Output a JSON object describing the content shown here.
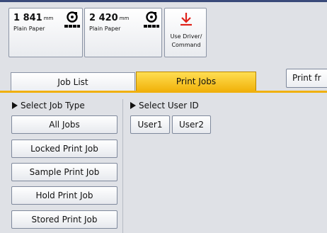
{
  "trays": [
    {
      "size_value": "1 841",
      "size_unit": "mm",
      "paper_type": "Plain Paper",
      "icon": "paper-roll-icon"
    },
    {
      "size_value": "2 420",
      "size_unit": "mm",
      "paper_type": "Plain Paper",
      "icon": "paper-roll-icon"
    }
  ],
  "driver_setting": {
    "icon": "download-arrow-icon",
    "label": "Use Driver/ Command",
    "line1": "Use Driver/",
    "line2": "Command",
    "icon_color": "#e0221a"
  },
  "tabs": [
    {
      "label": "Job List",
      "active": false
    },
    {
      "label": "Print Jobs",
      "active": true
    }
  ],
  "print_from_button": {
    "label": "Print fr"
  },
  "job_type_section": {
    "heading": "Select Job Type",
    "buttons": [
      "All Jobs",
      "Locked Print Job",
      "Sample Print Job",
      "Hold Print Job",
      "Stored Print Job"
    ]
  },
  "user_section": {
    "heading": "Select User ID",
    "users": [
      "User1",
      "User2"
    ]
  },
  "colors": {
    "active_tab": "#f5c021",
    "background": "#dfe1e6",
    "accent_line": "#f0b00e"
  }
}
